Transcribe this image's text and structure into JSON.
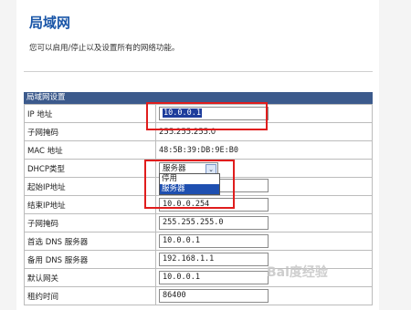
{
  "title": "局域网",
  "description": "您可以启用/停止以及设置所有的网络功能。",
  "section": {
    "header": "局域网设置"
  },
  "rows": [
    {
      "label": "IP 地址",
      "value": "10.0.0.1"
    },
    {
      "label": "子网掩码",
      "value": "255.255.255.0"
    },
    {
      "label": "MAC 地址",
      "value": "48:5B:39:DB:9E:B0"
    },
    {
      "label": "DHCP类型",
      "value": "服务器"
    },
    {
      "label": "起始IP地址",
      "value": ""
    },
    {
      "label": "结束IP地址",
      "value": "10.0.0.254"
    },
    {
      "label": "子网掩码",
      "value": "255.255.255.0"
    },
    {
      "label": "首选 DNS 服务器",
      "value": "10.0.0.1"
    },
    {
      "label": "备用 DNS 服务器",
      "value": "192.168.1.1"
    },
    {
      "label": "默认网关",
      "value": "10.0.0.1"
    },
    {
      "label": "租约时间",
      "value": "86400"
    }
  ],
  "dhcp_dropdown": {
    "options": [
      "停用",
      "服务器"
    ],
    "highlighted": "服务器"
  },
  "watermark": "Bai度经验",
  "colors": {
    "title": "#1a56a8",
    "section_header": "#3c5a8c",
    "highlight": "#e01d1d"
  }
}
